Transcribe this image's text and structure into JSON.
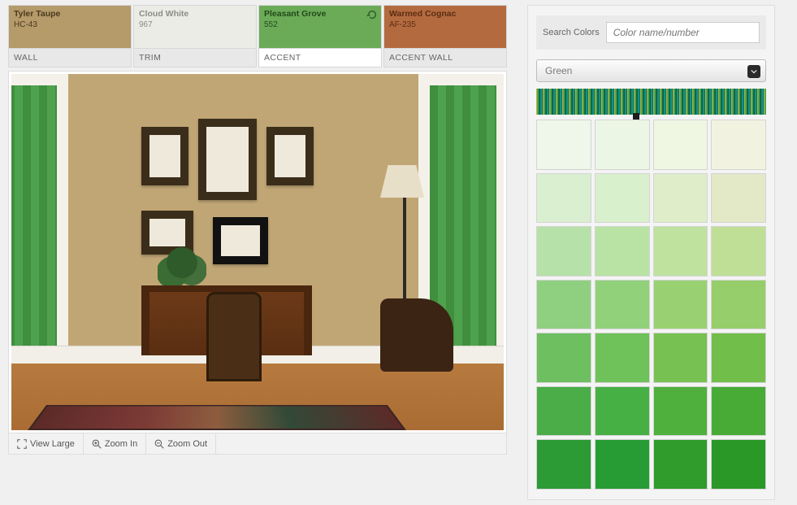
{
  "swatches": [
    {
      "name": "Tyler Taupe",
      "code": "HC-43",
      "role": "WALL",
      "bg": "#b59a6a",
      "fg": "#4a3a1e",
      "refresh": false
    },
    {
      "name": "Cloud White",
      "code": "967",
      "role": "TRIM",
      "bg": "#ecece6",
      "fg": "#8c8c88",
      "refresh": false
    },
    {
      "name": "Pleasant Grove",
      "code": "552",
      "role": "ACCENT",
      "bg": "#6bab58",
      "fg": "#23491a",
      "refresh": true,
      "active": true
    },
    {
      "name": "Warmed Cognac",
      "code": "AF-235",
      "role": "ACCENT WALL",
      "bg": "#b46a3f",
      "fg": "#5a2e14",
      "refresh": false
    }
  ],
  "controls": {
    "view_large": "View Large",
    "zoom_in": "Zoom In",
    "zoom_out": "Zoom Out"
  },
  "search": {
    "label": "Search Colors",
    "placeholder": "Color name/number"
  },
  "family": {
    "selected": "Green"
  },
  "palette_grid": [
    [
      "#eef7e9",
      "#ecf6e4",
      "#eff7e2",
      "#f1f3e0"
    ],
    [
      "#d9efd0",
      "#d9f0cd",
      "#dfeec9",
      "#e3e8c7"
    ],
    [
      "#b6e1a9",
      "#b8e3a4",
      "#bfe29f",
      "#bfdf96"
    ],
    [
      "#8fcf80",
      "#90d17a",
      "#99d172",
      "#96ce6b"
    ],
    [
      "#6dbf60",
      "#6fc259",
      "#77c153",
      "#72be4b"
    ],
    [
      "#4aad47",
      "#47b044",
      "#4fb03d",
      "#47ab36"
    ],
    [
      "#2d9b35",
      "#289c34",
      "#2f9c2c",
      "#2a9826"
    ]
  ]
}
